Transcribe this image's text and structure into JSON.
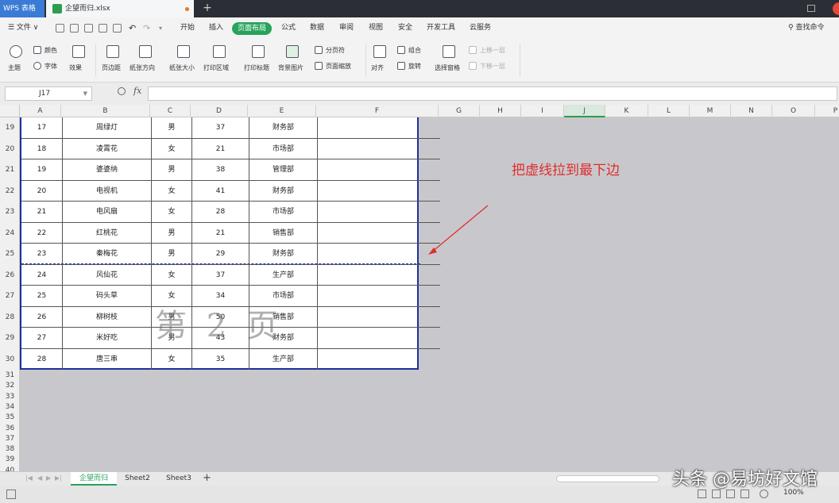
{
  "titlebar": {
    "app_name": "WPS 表格",
    "file_name": "企望而归.xlsx",
    "new_tab": "+"
  },
  "menu": {
    "file": "☰ 文件 ∨",
    "items": [
      "开始",
      "插入",
      "页面布局",
      "公式",
      "数据",
      "审阅",
      "视图",
      "安全",
      "开发工具",
      "云服务"
    ],
    "active": "页面布局",
    "search": "查找命令"
  },
  "ribbon": {
    "theme": "主题",
    "color": "颜色",
    "font": "字体",
    "effect": "效果",
    "margins": "页边距",
    "orientation": "纸张方向",
    "size": "纸张大小",
    "print_area": "打印区域",
    "print_titles": "打印标题",
    "background": "背景图片",
    "page_break": "分页符",
    "page_zoom": "页面缩放",
    "align": "对齐",
    "group": "组合",
    "rotate": "旋转",
    "select_pane": "选择窗格",
    "bring_forward": "上移一层",
    "send_backward": "下移一层"
  },
  "formula": {
    "name_box": "J17",
    "fx": "fx",
    "value": ""
  },
  "columns": [
    "A",
    "B",
    "C",
    "D",
    "E",
    "F",
    "G",
    "H",
    "I",
    "J",
    "K",
    "L",
    "M",
    "N",
    "O",
    "P"
  ],
  "selected_column": "J",
  "rows": [
    {
      "n": "19",
      "cells": [
        "17",
        "周绿灯",
        "男",
        "37",
        "财务部"
      ]
    },
    {
      "n": "20",
      "cells": [
        "18",
        "凌霄花",
        "女",
        "21",
        "市场部"
      ]
    },
    {
      "n": "21",
      "cells": [
        "19",
        "婆婆纳",
        "男",
        "38",
        "管理部"
      ]
    },
    {
      "n": "22",
      "cells": [
        "20",
        "电视机",
        "女",
        "41",
        "财务部"
      ]
    },
    {
      "n": "23",
      "cells": [
        "21",
        "电风扇",
        "女",
        "28",
        "市场部"
      ]
    },
    {
      "n": "24",
      "cells": [
        "22",
        "红桃花",
        "男",
        "21",
        "销售部"
      ]
    },
    {
      "n": "25",
      "cells": [
        "23",
        "秦梅花",
        "男",
        "29",
        "财务部"
      ]
    },
    {
      "n": "26",
      "cells": [
        "24",
        "风仙花",
        "女",
        "37",
        "生产部"
      ]
    },
    {
      "n": "27",
      "cells": [
        "25",
        "码头草",
        "女",
        "34",
        "市场部"
      ]
    },
    {
      "n": "28",
      "cells": [
        "26",
        "柳树枝",
        "男",
        "50",
        "销售部"
      ]
    },
    {
      "n": "29",
      "cells": [
        "27",
        "米好吃",
        "男",
        "43",
        "财务部"
      ]
    },
    {
      "n": "30",
      "cells": [
        "28",
        "唐三串",
        "女",
        "35",
        "生产部"
      ]
    }
  ],
  "empty_rows": [
    "31",
    "32",
    "33",
    "34",
    "35",
    "36",
    "37",
    "38",
    "39",
    "40"
  ],
  "watermark": "第 2 页",
  "annotation": "把虚线拉到最下边",
  "sheets": {
    "tabs": [
      "企望而归",
      "Sheet2",
      "Sheet3"
    ],
    "active": "企望而归",
    "add": "+"
  },
  "status": {
    "zoom": "100%"
  },
  "credit": "头条 @易坊好文馆"
}
